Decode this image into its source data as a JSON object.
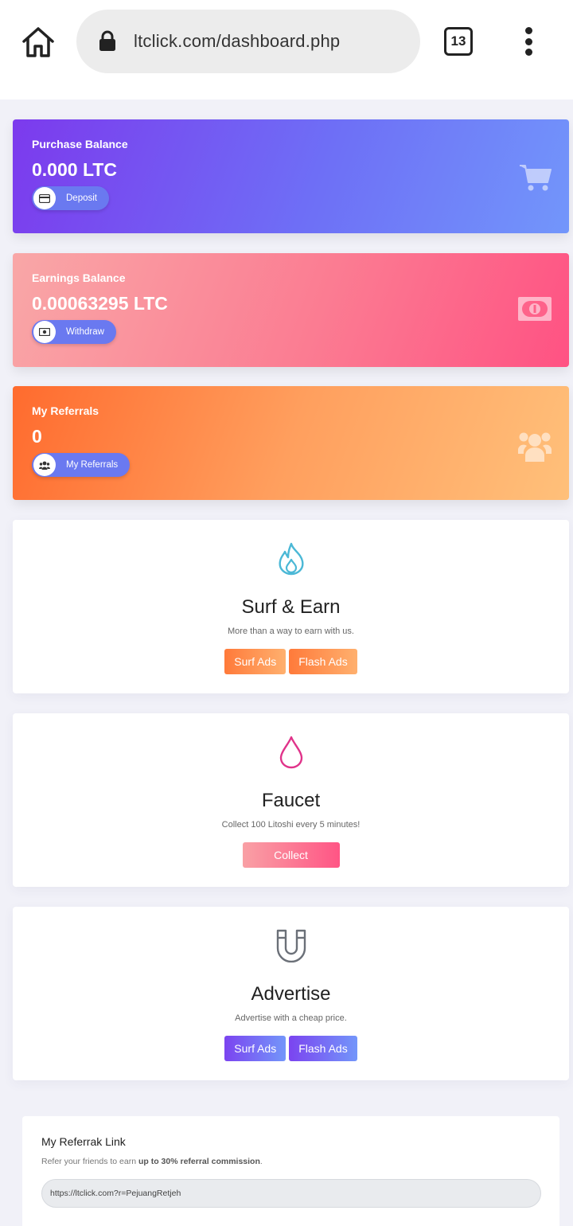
{
  "browser": {
    "url": "ltclick.com/dashboard.php",
    "tab_count": "13"
  },
  "cards": {
    "purchase": {
      "label": "Purchase Balance",
      "value": "0.000 LTC",
      "button": "Deposit",
      "icon": "cart-icon"
    },
    "earnings": {
      "label": "Earnings Balance",
      "value": "0.00063295 LTC",
      "button": "Withdraw",
      "icon": "money-bill-icon"
    },
    "referrals": {
      "label": "My Referrals",
      "value": "0",
      "button": "My Referrals",
      "icon": "users-icon"
    }
  },
  "features": {
    "surf": {
      "title": "Surf & Earn",
      "desc": "More than a way to earn with us.",
      "btn1": "Surf Ads",
      "btn2": "Flash Ads",
      "icon": "fire-icon"
    },
    "faucet": {
      "title": "Faucet",
      "desc": "Collect 100 Litoshi every 5 minutes!",
      "btn1": "Collect",
      "icon": "drop-icon"
    },
    "advertise": {
      "title": "Advertise",
      "desc": "Advertise with a cheap price.",
      "btn1": "Surf Ads",
      "btn2": "Flash Ads",
      "icon": "magnet-icon"
    }
  },
  "referral_link": {
    "title": "My Referrak Link",
    "desc_prefix": "Refer your friends to earn ",
    "desc_bold": "up to 30% referral commission",
    "desc_suffix": ".",
    "value": "https://ltclick.com?r=PejuangRetjeh"
  },
  "colors": {
    "purple_start": "#7c3aed",
    "blue_end": "#7296fb",
    "pink_end": "#ff5283",
    "orange_start": "#ff6b2e",
    "teal_icon": "#4bb8d6",
    "magenta_icon": "#e0338a",
    "gray_icon": "#6b7078"
  }
}
